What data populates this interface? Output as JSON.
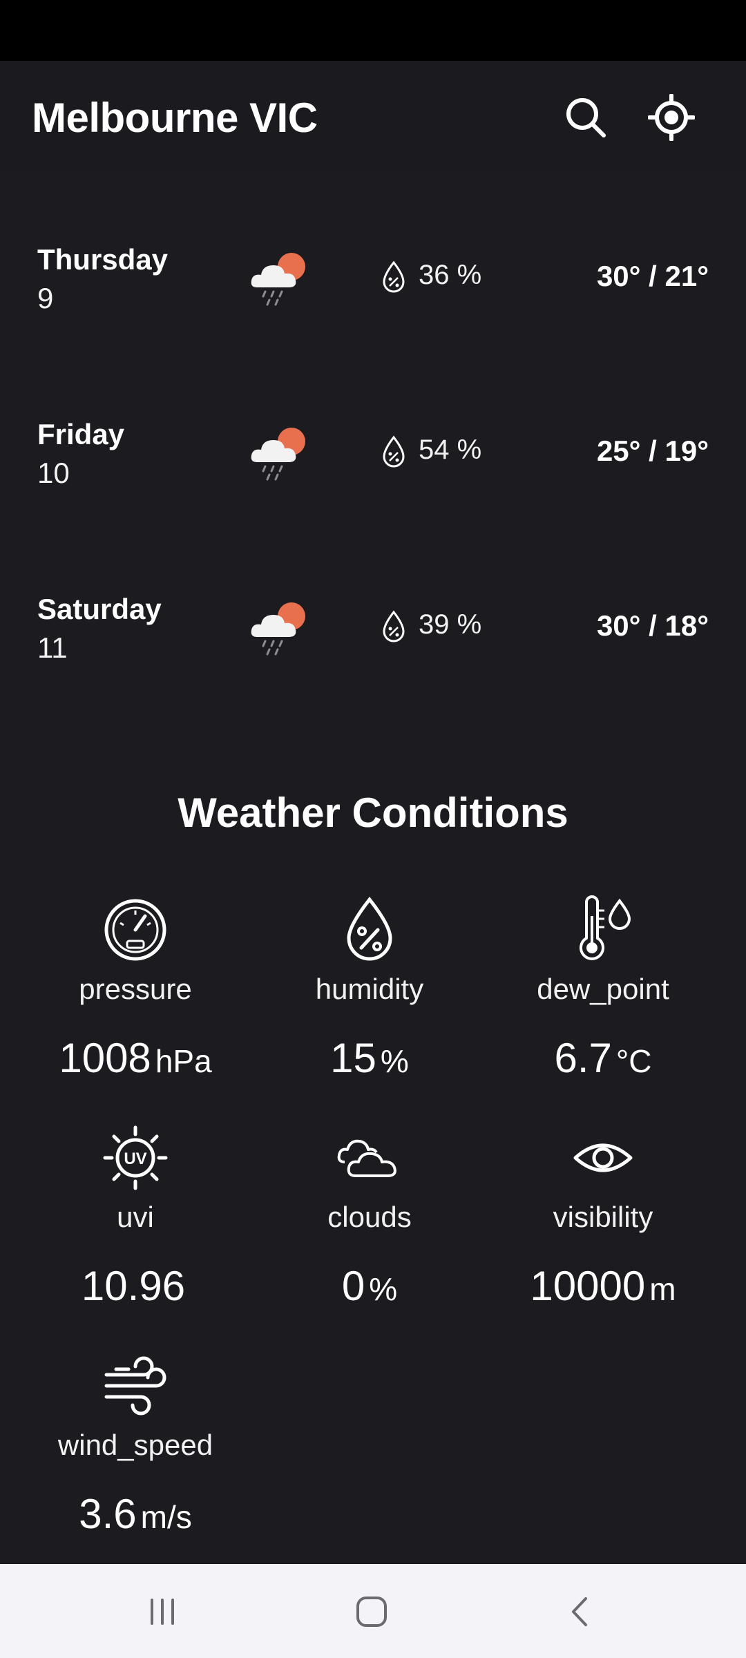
{
  "header": {
    "title": "Melbourne VIC",
    "search_icon": "search-icon",
    "location_icon": "my-location-icon"
  },
  "forecast": [
    {
      "day": "Thursday",
      "date": "9",
      "pop": "36 %",
      "temp": "30° / 21°"
    },
    {
      "day": "Friday",
      "date": "10",
      "pop": "54 %",
      "temp": "25° / 19°"
    },
    {
      "day": "Saturday",
      "date": "11",
      "pop": "39 %",
      "temp": "30° / 18°"
    }
  ],
  "conditions_title": "Weather Conditions",
  "conditions": {
    "pressure": {
      "label": "pressure",
      "value": "1008",
      "unit": "hPa",
      "icon": "gauge-icon"
    },
    "humidity": {
      "label": "humidity",
      "value": "15",
      "unit": "%",
      "icon": "humidity-drop-icon"
    },
    "dew_point": {
      "label": "dew_point",
      "value": "6.7",
      "unit": "°C",
      "icon": "thermometer-drop-icon"
    },
    "uvi": {
      "label": "uvi",
      "value": "10.96",
      "unit": "",
      "icon": "uv-sun-icon"
    },
    "clouds": {
      "label": "clouds",
      "value": "0",
      "unit": "%",
      "icon": "clouds-icon"
    },
    "visibility": {
      "label": "visibility",
      "value": "10000",
      "unit": "m",
      "icon": "eye-icon"
    },
    "wind_speed": {
      "label": "wind_speed",
      "value": "3.6",
      "unit": "m/s",
      "icon": "wind-icon"
    }
  },
  "colors": {
    "background": "#1c1b20",
    "sun": "#e8704f",
    "cloud": "#f2f2f2",
    "navbar": "#f4f3f8"
  }
}
